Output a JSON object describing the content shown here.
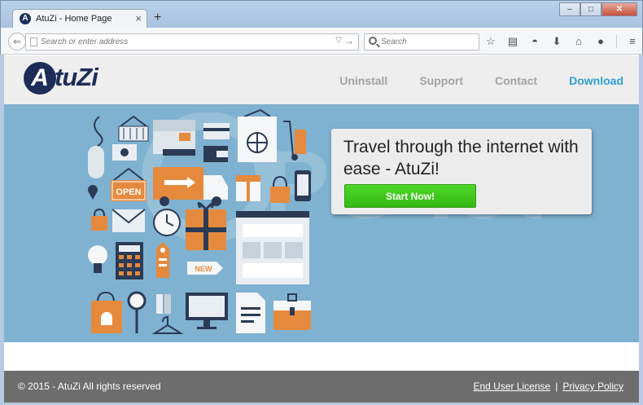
{
  "browser": {
    "tab_title": "AtuZi - Home Page",
    "tab_favicon_letter": "A",
    "tab_close": "×",
    "new_tab": "+",
    "window_buttons": {
      "minimize": "–",
      "maximize": "□",
      "close": "✕"
    },
    "address_placeholder": "Search or enter address",
    "search_placeholder": "Search",
    "toolbar_icons": [
      "star-icon",
      "reading-list-icon",
      "pocket-icon",
      "download-icon",
      "home-icon",
      "chat-icon",
      "menu-icon"
    ]
  },
  "header": {
    "logo_first": "A",
    "logo_rest": "tuZi",
    "nav": [
      "Uninstall",
      "Support",
      "Contact",
      "Download"
    ],
    "active_nav": "Download",
    "nav_colors": {
      "default": "#a0a3a6",
      "active": "#2f9fd1"
    }
  },
  "hero": {
    "background": "#7fb1d0",
    "headline": "Travel through the internet with ease - AtuZi!",
    "cta_label": "Start Now!",
    "cta_color": "#3cc41b",
    "illustration_labels": {
      "open_sign": "OPEN",
      "new_tag": "NEW"
    },
    "watermark_text": "PC .com"
  },
  "footer": {
    "copyright": "© 2015 - AtuZi All rights reserved",
    "links": [
      "End User License",
      "Privacy Policy"
    ],
    "separator": "|"
  }
}
